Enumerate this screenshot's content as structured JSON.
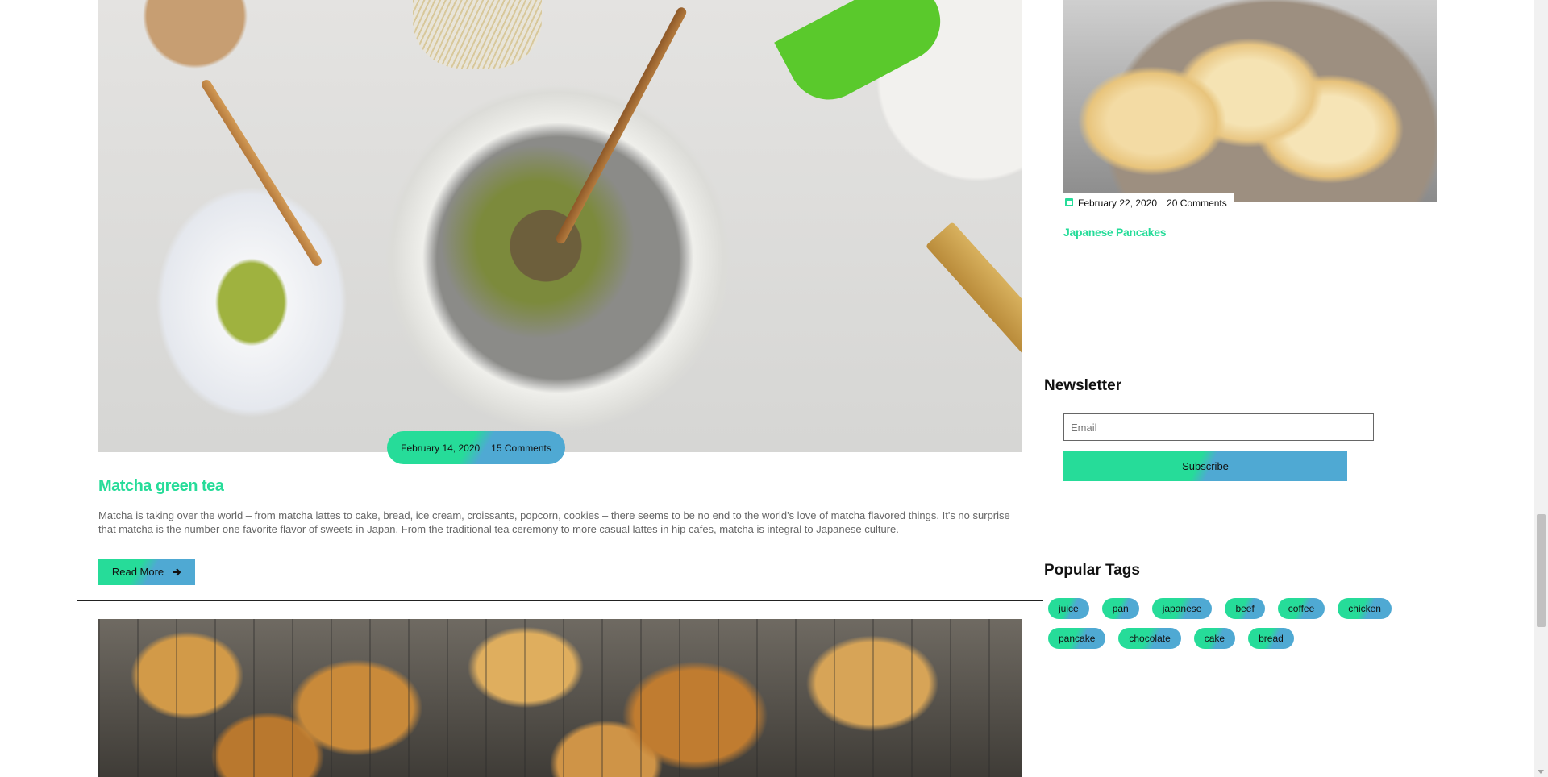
{
  "post": {
    "date": "February 14, 2020",
    "comments": "15 Comments",
    "title": "Matcha green tea",
    "excerpt": "Matcha is taking over the world – from matcha lattes to cake, bread, ice cream, croissants, popcorn, cookies – there seems to be no end to the world's love of matcha flavored things. It's no surprise that matcha is the number one favorite flavor of sweets in Japan. From the traditional tea ceremony to more casual lattes in hip cafes, matcha is integral to Japanese culture.",
    "read_more": "Read More",
    "read_more_icon": "arrow-right-icon"
  },
  "sidebar": {
    "recent_post": {
      "date": "February 22, 2020",
      "comments": "20 Comments",
      "title": "Japanese Pancakes",
      "date_icon": "calendar-icon"
    },
    "newsletter": {
      "title": "Newsletter",
      "email_placeholder": "Email",
      "subscribe_label": "Subscribe"
    },
    "popular_tags": {
      "title": "Popular Tags",
      "tags": [
        "juice",
        "pan",
        "japanese",
        "beef",
        "coffee",
        "chicken",
        "pancake",
        "chocolate",
        "cake",
        "bread"
      ]
    }
  },
  "colors": {
    "accent_green": "#26dc99",
    "accent_blue": "#4fa9d3"
  }
}
